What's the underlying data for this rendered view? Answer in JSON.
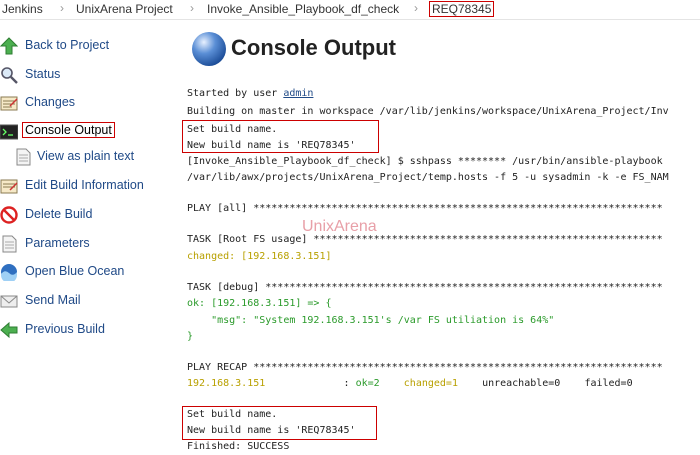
{
  "breadcrumb": [
    "Jenkins",
    "UnixArena Project",
    "Invoke_Ansible_Playbook_df_check",
    "REQ78345"
  ],
  "sidebar": {
    "items": [
      {
        "label": "Back to Project",
        "icon": "up-arrow-icon"
      },
      {
        "label": "Status",
        "icon": "magnifier-icon"
      },
      {
        "label": "Changes",
        "icon": "notepad-icon"
      },
      {
        "label": "Console Output",
        "icon": "terminal-icon"
      },
      {
        "label": "View as plain text",
        "icon": "document-icon"
      },
      {
        "label": "Edit Build Information",
        "icon": "notepad-edit-icon"
      },
      {
        "label": "Delete Build",
        "icon": "no-entry-icon"
      },
      {
        "label": "Parameters",
        "icon": "document-icon"
      },
      {
        "label": "Open Blue Ocean",
        "icon": "blue-ocean-icon"
      },
      {
        "label": "Send Mail",
        "icon": "envelope-icon"
      },
      {
        "label": "Previous Build",
        "icon": "left-arrow-icon"
      }
    ]
  },
  "main": {
    "title": "Console Output",
    "watermark": "UnixArena",
    "console": {
      "started_prefix": "Started by user ",
      "started_user": "admin",
      "building": "Building on master in workspace /var/lib/jenkins/workspace/UnixArena_Project/Inv",
      "set_name_1": "Set build name.",
      "new_name_1": "New build name is 'REQ78345'",
      "cmd_1": "[Invoke_Ansible_Playbook_df_check] $ sshpass ******** /usr/bin/ansible-playbook",
      "cmd_2": "/var/lib/awx/projects/UnixArena_Project/temp.hosts -f 5 -u sysadmin -k -e FS_NAM",
      "play": "PLAY [all] ********************************************************************",
      "task_root": "TASK [Root FS usage] **********************************************************",
      "changed": "changed: [192.168.3.151]",
      "task_debug": "TASK [debug] ******************************************************************",
      "ok_line": "ok: [192.168.3.151] => {",
      "msg_line": "    \"msg\": \"System 192.168.3.151's /var FS utiliation is 64%\"",
      "close_brace": "}",
      "recap": "PLAY RECAP ********************************************************************",
      "recap_host": "192.168.3.151",
      "recap_sep": "             : ",
      "recap_ok": "ok=2",
      "recap_changed": "changed=1",
      "recap_unreach": "unreachable=0",
      "recap_failed": "failed=0",
      "set_name_2": "Set build name.",
      "new_name_2": "New build name is 'REQ78345'",
      "finished": "Finished: SUCCESS"
    }
  },
  "colors": {
    "accent": "#204a87",
    "highlight_box": "#cc0000",
    "ansible_green": "#2a9a2a",
    "ansible_yellow": "#b8a000"
  }
}
